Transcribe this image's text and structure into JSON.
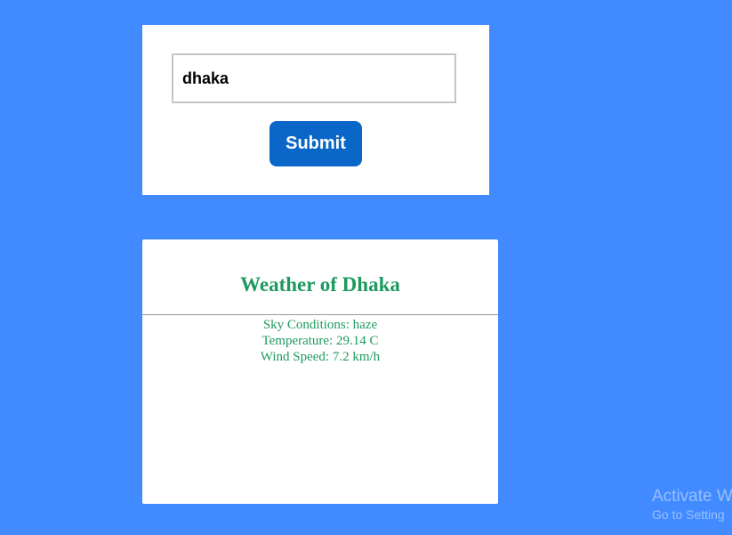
{
  "search": {
    "input_value": "dhaka",
    "submit_label": "Submit"
  },
  "weather": {
    "title": "Weather of Dhaka",
    "details": [
      "Sky Conditions: haze",
      "Temperature: 29.14 C",
      "Wind Speed: 7.2 km/h"
    ]
  },
  "watermark": {
    "line1": "Activate W",
    "line2": "Go to Setting"
  },
  "colors": {
    "background": "#428aff",
    "button": "#0a67c8",
    "weather_text": "#1e9a5e"
  }
}
